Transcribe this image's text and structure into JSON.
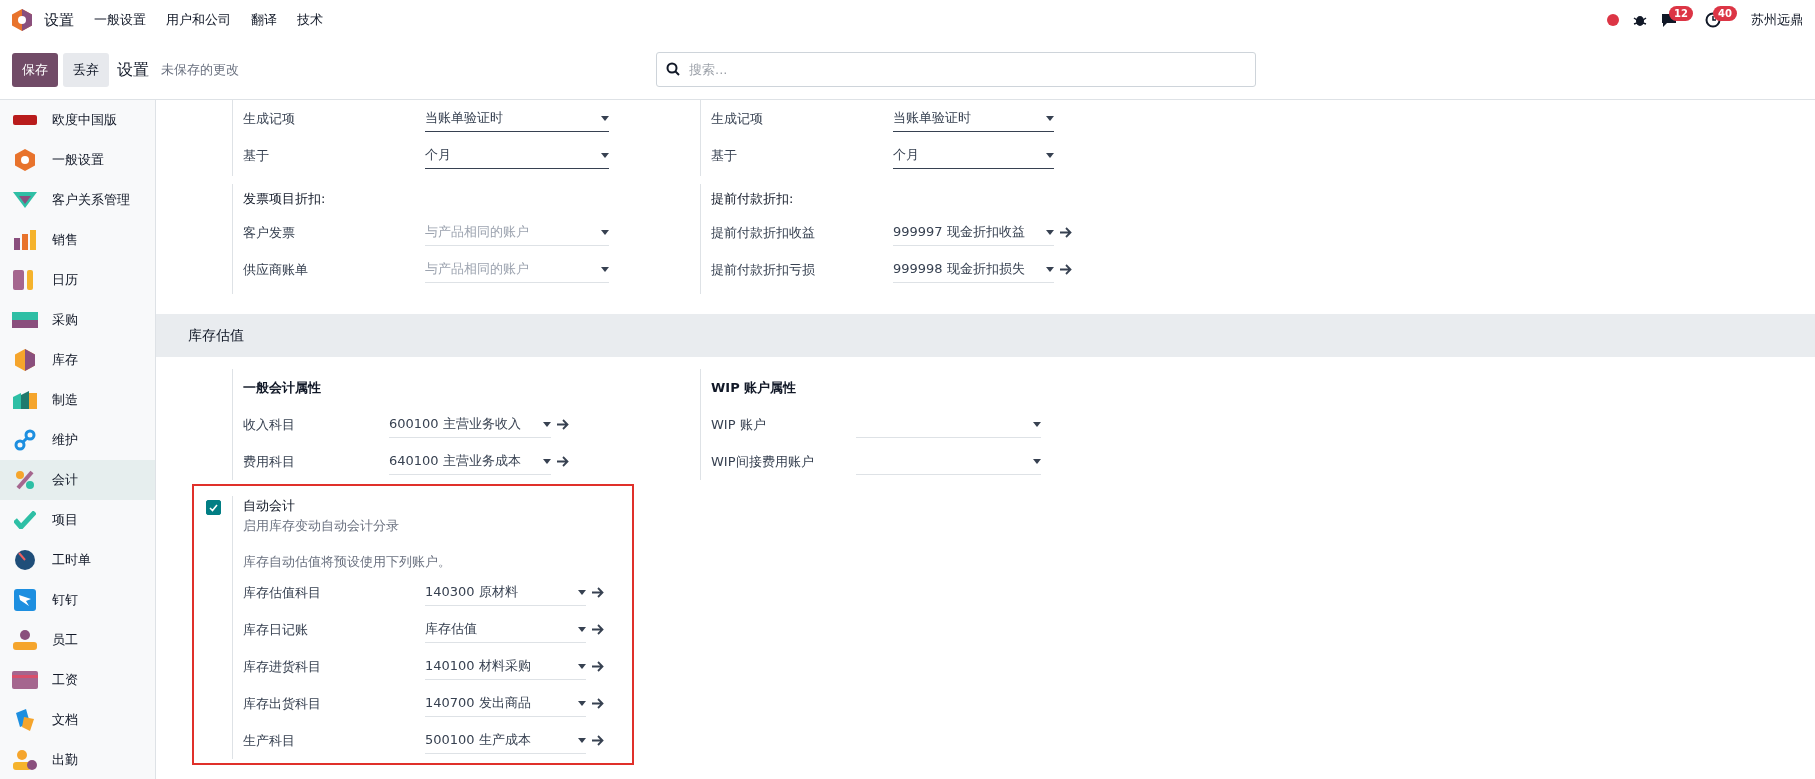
{
  "topbar": {
    "app_title": "设置",
    "menu": [
      "一般设置",
      "用户和公司",
      "翻译",
      "技术"
    ],
    "chat_count": "12",
    "activity_count": "40",
    "company": "苏州远鼎"
  },
  "control_bar": {
    "save": "保存",
    "discard": "丢弃",
    "title": "设置",
    "status": "未保存的更改",
    "search": {
      "placeholder": "搜索..."
    }
  },
  "sidebar": {
    "items": [
      {
        "label": "欧度中国版",
        "selected": false
      },
      {
        "label": "一般设置",
        "selected": false
      },
      {
        "label": "客户关系管理",
        "selected": false
      },
      {
        "label": "销售",
        "selected": false
      },
      {
        "label": "日历",
        "selected": false
      },
      {
        "label": "采购",
        "selected": false
      },
      {
        "label": "库存",
        "selected": false
      },
      {
        "label": "制造",
        "selected": false
      },
      {
        "label": "维护",
        "selected": false
      },
      {
        "label": "会计",
        "selected": true
      },
      {
        "label": "项目",
        "selected": false
      },
      {
        "label": "工时单",
        "selected": false
      },
      {
        "label": "钉钉",
        "selected": false
      },
      {
        "label": "员工",
        "selected": false
      },
      {
        "label": "工资",
        "selected": false
      },
      {
        "label": "文档",
        "selected": false
      },
      {
        "label": "出勤",
        "selected": false
      }
    ]
  },
  "upper": {
    "columns": [
      {
        "groups": [
          {
            "fields": [
              {
                "label": "生成记项",
                "kind": "selection",
                "value": "当账单验证时",
                "link": false
              },
              {
                "label": "基于",
                "kind": "selection",
                "value": "个月",
                "link": false
              }
            ]
          },
          {
            "title": "发票项目折扣:",
            "fields": [
              {
                "label": "客户发票",
                "kind": "record",
                "placeholder": "与产品相同的账户",
                "link": false
              },
              {
                "label": "供应商账单",
                "kind": "record",
                "placeholder": "与产品相同的账户",
                "link": false
              }
            ]
          }
        ]
      },
      {
        "groups": [
          {
            "fields": [
              {
                "label": "生成记项",
                "kind": "selection",
                "value": "当账单验证时",
                "link": false
              },
              {
                "label": "基于",
                "kind": "selection",
                "value": "个月",
                "link": false
              }
            ]
          },
          {
            "title": "提前付款折扣:",
            "fields": [
              {
                "label": "提前付款折扣收益",
                "kind": "record",
                "value": "999997 现金折扣收益",
                "link": true
              },
              {
                "label": "提前付款折扣亏损",
                "kind": "record",
                "value": "999998 现金折扣损失",
                "link": true
              }
            ]
          }
        ]
      }
    ]
  },
  "section": {
    "title": "库存估值",
    "columns": [
      {
        "title": "一般会计属性",
        "fields": [
          {
            "label": "收入科目",
            "kind": "record",
            "value": "600100 主营业务收入",
            "link": true
          },
          {
            "label": "费用科目",
            "kind": "record",
            "value": "640100 主营业务成本",
            "link": true
          }
        ]
      },
      {
        "title": "WIP 账户属性",
        "fields": [
          {
            "label": "WIP 账户",
            "kind": "record",
            "link": false
          },
          {
            "label": "WIP间接费用账户",
            "kind": "record",
            "link": false
          }
        ]
      }
    ]
  },
  "auto_accounting": {
    "checked": true,
    "title": "自动会计",
    "description": "启用库存变动自动会计分录",
    "note": "库存自动估值将预设使用下列账户。",
    "fields": [
      {
        "label": "库存估值科目",
        "kind": "record",
        "value": "140300 原材料",
        "link": true
      },
      {
        "label": "库存日记账",
        "kind": "record",
        "value": "库存估值",
        "link": true
      },
      {
        "label": "库存进货科目",
        "kind": "record",
        "value": "140100 材料采购",
        "link": true
      },
      {
        "label": "库存出货科目",
        "kind": "record",
        "value": "140700 发出商品",
        "link": true
      },
      {
        "label": "生产科目",
        "kind": "record",
        "value": "500100 生产成本",
        "link": true
      }
    ]
  }
}
